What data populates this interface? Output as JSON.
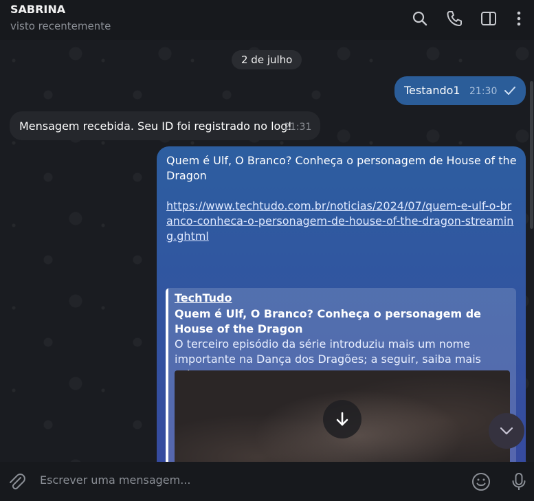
{
  "header": {
    "contact_name": "SABRINA",
    "status": "visto recentemente",
    "icons": [
      "search-icon",
      "phone-icon",
      "sidebar-toggle-icon",
      "more-vertical-icon"
    ]
  },
  "chat": {
    "date_separator": "2 de julho",
    "messages": [
      {
        "direction": "outgoing",
        "text": "Testando1",
        "time": "21:30",
        "status": "read"
      },
      {
        "direction": "incoming",
        "text": "Mensagem recebida. Seu ID foi registrado no log!",
        "time": "21:31"
      },
      {
        "direction": "outgoing",
        "text": "Quem é Ulf, O Branco? Conheça o personagem de House of the Dragon",
        "link": "https://www.techtudo.com.br/noticias/2024/07/quem-e-ulf-o-branco-conheca-o-personagem-de-house-of-the-dragon-streaming.ghtml",
        "preview": {
          "site": "TechTudo",
          "title": "Quem é Ulf, O Branco? Conheça o personagem de House of the Dragon",
          "description": "O terceiro episódio da série introduziu mais um nome importante na Dança dos Dragões; a seguir, saiba mais sobre ..."
        }
      }
    ]
  },
  "composer": {
    "placeholder": "Escrever uma mensagem...",
    "icons": [
      "attach-icon",
      "emoji-icon",
      "microphone-icon"
    ]
  },
  "colors": {
    "outgoing_bubble": "#2b5d99",
    "incoming_bubble": "#25272c",
    "header_bg": "#17191d"
  }
}
